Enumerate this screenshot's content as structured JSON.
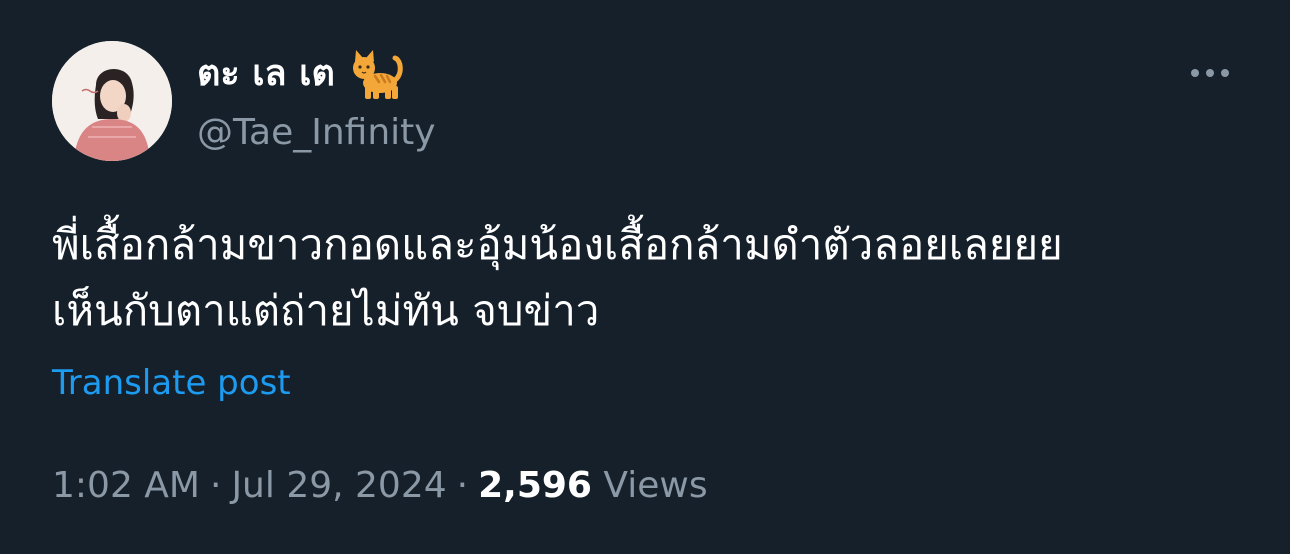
{
  "user": {
    "display_name": "ตะ เล เต",
    "name_emoji_icon": "cat-emoji-icon",
    "handle": "@Tae_Infinity"
  },
  "tweet": {
    "text_lines": [
      "พี่เสื้อกล้ามขาวกอดและอุ้มน้องเสื้อกล้ามดำตัวลอยเลยยย",
      "เห็นกับตาแต่ถ่ายไม่ทัน จบข่าว"
    ],
    "translate_label": "Translate post"
  },
  "meta": {
    "time": "1:02 AM",
    "separator": "·",
    "date": "Jul 29, 2024",
    "views_count": "2,596",
    "views_label": "Views"
  },
  "colors": {
    "background": "#15202b",
    "primary_text": "#ffffff",
    "secondary_text": "#8b98a5",
    "link": "#1d9bf0"
  }
}
